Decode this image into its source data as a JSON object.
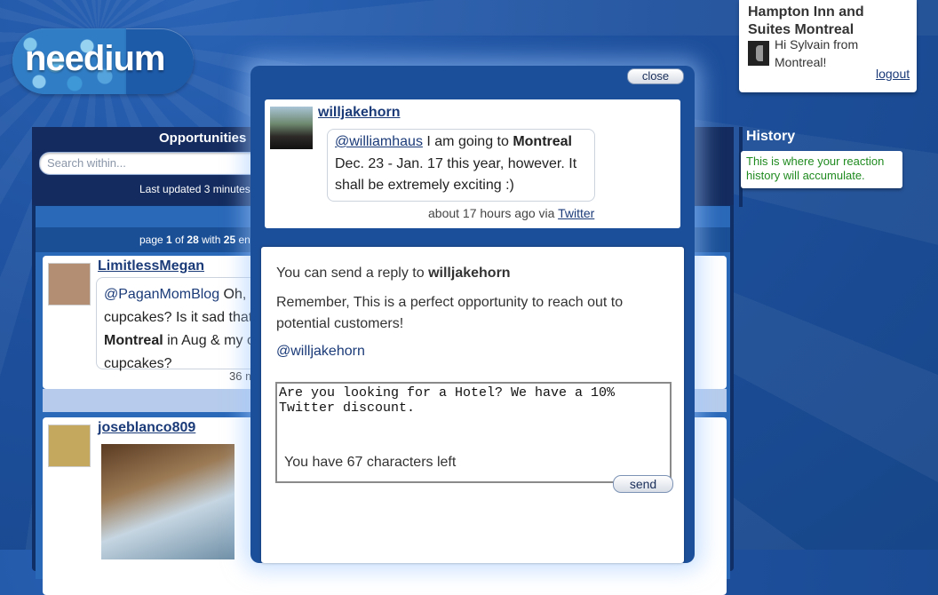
{
  "logo": {
    "text": "needium"
  },
  "header": {
    "hotel_name": "Hampton Inn and Suites Montreal",
    "greeting": "Hi Sylvain from Montreal!",
    "logout": "logout"
  },
  "left_panel": {
    "title": "Opportunities",
    "search_placeholder": "Search within...",
    "updated": "Last updated 3 minutes",
    "paging_page": "1",
    "paging_total": "28",
    "paging_with": "25",
    "tweets": [
      {
        "user": "LimitlessMegan",
        "mention": "@PaganMomBlog",
        "text_a": " Oh, c",
        "text_b": "cupcakes? Is it sad that",
        "bold": "Montreal",
        "text_c": " in Aug & my o",
        "text_d": "cupcakes?",
        "time": "36 m"
      },
      {
        "user": "joseblanco809"
      }
    ]
  },
  "history": {
    "title": "History",
    "text": "This is where your reaction history will accumulate."
  },
  "modal": {
    "close": "close",
    "original": {
      "user": "willjakehorn",
      "mention": "@williamhaus",
      "text_before": " I am going to ",
      "bold": "Montreal",
      "text_after": " Dec. 23 - Jan. 17 this year, however. It shall be extremely exciting :)",
      "meta_prefix": "about 17 hours ago via ",
      "meta_link": "Twitter"
    },
    "reply": {
      "line1_prefix": "You can send a reply to ",
      "line1_user": "willjakehorn",
      "line2": "Remember, This is a perfect opportunity to reach out to potential customers!",
      "mention": "@willjakehorn",
      "message": "Are you looking for a Hotel? We have a 10%\nTwitter discount.",
      "chars_left": "You have 67 characters left",
      "send": "send"
    }
  }
}
